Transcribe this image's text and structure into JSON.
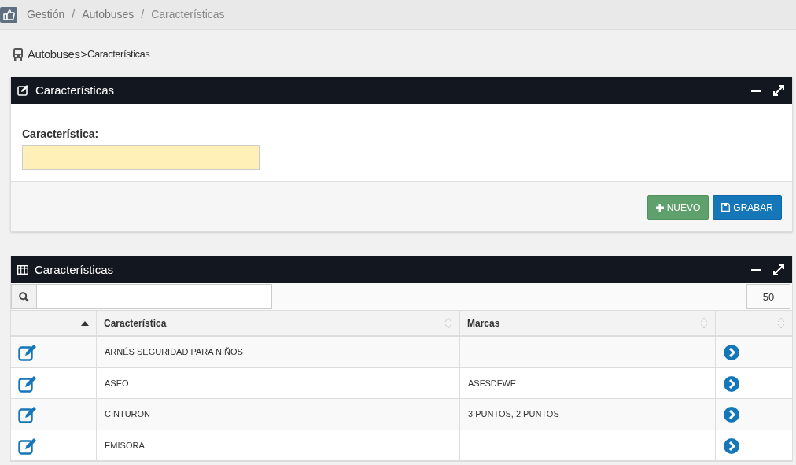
{
  "breadcrumb": [
    {
      "label": "Gestión"
    },
    {
      "separator": "/",
      "label": "Autobuses"
    },
    {
      "separator": "/",
      "label": "Características"
    }
  ],
  "page_path": {
    "section": "Autobuses",
    "separator": ">",
    "current": "Características"
  },
  "form_panel": {
    "title": "Características",
    "field_label": "Característica:",
    "buttons": [
      {
        "kind": "new",
        "label": "NUEVO"
      },
      {
        "kind": "save",
        "label": "GRABAR"
      }
    ]
  },
  "table_panel": {
    "title": "Características",
    "page_length": "50",
    "columns": [
      {
        "sorted": true
      },
      {
        "label": "Característica",
        "sorted": false
      },
      {
        "label": "Marcas",
        "sorted": false
      },
      {
        "sorted": false
      }
    ],
    "rows": [
      {
        "caracteristica": "ARNÉS SEGURIDAD PARA NIÑOS"
      },
      {
        "caracteristica": "ASEO",
        "marcas": "ASFSDFWE"
      },
      {
        "caracteristica": "CINTURON",
        "marcas": "3 PUNTOS, 2 PUNTOS"
      },
      {
        "caracteristica": "EMISORA"
      }
    ]
  }
}
